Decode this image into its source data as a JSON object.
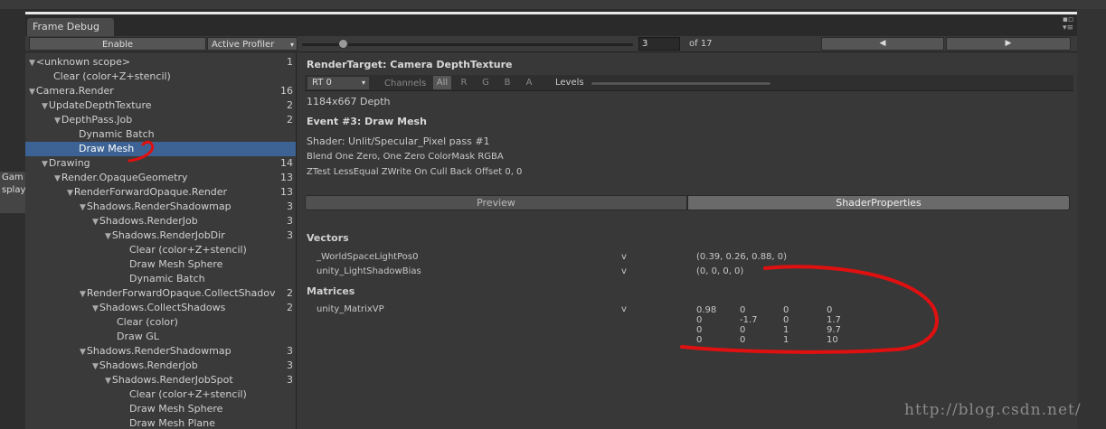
{
  "background": {
    "game_tab": "Gam",
    "display_label": "splay"
  },
  "window": {
    "tab_title": "Frame Debug",
    "icons": {
      "top": "▪▫",
      "bottom": "▾≡"
    }
  },
  "toolbar": {
    "enable_label": "Enable",
    "profiler_label": "Active Profiler",
    "profiler_arrow": "▾",
    "frame_value": "3",
    "of_label": "of 17",
    "prev_glyph": "◀",
    "next_glyph": "▶"
  },
  "tree": [
    {
      "label": "<unknown scope>",
      "count": "1",
      "indent": 0,
      "expanded": true,
      "selected": false
    },
    {
      "label": "Clear (color+Z+stencil)",
      "count": "",
      "indent": 1,
      "expanded": false,
      "selected": false
    },
    {
      "label": "Camera.Render",
      "count": "16",
      "indent": 0,
      "expanded": true,
      "selected": false
    },
    {
      "label": "UpdateDepthTexture",
      "count": "2",
      "indent": 1,
      "expanded": true,
      "selected": false
    },
    {
      "label": "DepthPass.Job",
      "count": "2",
      "indent": 2,
      "expanded": true,
      "selected": false
    },
    {
      "label": "Dynamic Batch",
      "count": "",
      "indent": 3,
      "expanded": false,
      "selected": false
    },
    {
      "label": "Draw Mesh",
      "count": "",
      "indent": 3,
      "expanded": false,
      "selected": true
    },
    {
      "label": "Drawing",
      "count": "14",
      "indent": 1,
      "expanded": true,
      "selected": false
    },
    {
      "label": "Render.OpaqueGeometry",
      "count": "13",
      "indent": 2,
      "expanded": true,
      "selected": false
    },
    {
      "label": "RenderForwardOpaque.Render",
      "count": "13",
      "indent": 3,
      "expanded": true,
      "selected": false
    },
    {
      "label": "Shadows.RenderShadowmap",
      "count": "3",
      "indent": 4,
      "expanded": true,
      "selected": false
    },
    {
      "label": "Shadows.RenderJob",
      "count": "3",
      "indent": 5,
      "expanded": true,
      "selected": false
    },
    {
      "label": "Shadows.RenderJobDir",
      "count": "3",
      "indent": 6,
      "expanded": true,
      "selected": false
    },
    {
      "label": "Clear (color+Z+stencil)",
      "count": "",
      "indent": 7,
      "expanded": false,
      "selected": false
    },
    {
      "label": "Draw Mesh Sphere",
      "count": "",
      "indent": 7,
      "expanded": false,
      "selected": false
    },
    {
      "label": "Dynamic Batch",
      "count": "",
      "indent": 7,
      "expanded": false,
      "selected": false
    },
    {
      "label": "RenderForwardOpaque.CollectShadov",
      "count": "2",
      "indent": 4,
      "expanded": true,
      "selected": false
    },
    {
      "label": "Shadows.CollectShadows",
      "count": "2",
      "indent": 5,
      "expanded": true,
      "selected": false
    },
    {
      "label": "Clear (color)",
      "count": "",
      "indent": 6,
      "expanded": false,
      "selected": false
    },
    {
      "label": "Draw GL",
      "count": "",
      "indent": 6,
      "expanded": false,
      "selected": false
    },
    {
      "label": "Shadows.RenderShadowmap",
      "count": "3",
      "indent": 4,
      "expanded": true,
      "selected": false
    },
    {
      "label": "Shadows.RenderJob",
      "count": "3",
      "indent": 5,
      "expanded": true,
      "selected": false
    },
    {
      "label": "Shadows.RenderJobSpot",
      "count": "3",
      "indent": 6,
      "expanded": true,
      "selected": false
    },
    {
      "label": "Clear (color+Z+stencil)",
      "count": "",
      "indent": 7,
      "expanded": false,
      "selected": false
    },
    {
      "label": "Draw Mesh Sphere",
      "count": "",
      "indent": 7,
      "expanded": false,
      "selected": false
    },
    {
      "label": "Draw Mesh Plane",
      "count": "",
      "indent": 7,
      "expanded": false,
      "selected": false
    }
  ],
  "render_target": {
    "title": "RenderTarget: Camera DepthTexture",
    "rt_select": "RT 0",
    "rt_arrow": "▾",
    "channels_label": "Channels",
    "channels": [
      "All",
      "R",
      "G",
      "B",
      "A"
    ],
    "levels_label": "Levels",
    "resolution": "1184x667 Depth"
  },
  "event": {
    "title": "Event #3: Draw Mesh",
    "shader": "Shader: Unlit/Specular_Pixel pass #1",
    "blend": "Blend One Zero, One Zero ColorMask RGBA",
    "ztest": "ZTest LessEqual ZWrite On Cull Back Offset 0, 0"
  },
  "tabs": {
    "preview": "Preview",
    "shader_properties": "ShaderProperties"
  },
  "vectors": {
    "heading": "Vectors",
    "items": [
      {
        "name": "_WorldSpaceLightPos0",
        "stage": "v",
        "value": "(0.39, 0.26, 0.88, 0)"
      },
      {
        "name": "unity_LightShadowBias",
        "stage": "v",
        "value": "(0, 0, 0, 0)"
      }
    ]
  },
  "matrices": {
    "heading": "Matrices",
    "items": [
      {
        "name": "unity_MatrixVP",
        "stage": "v",
        "rows": [
          [
            "0.98",
            "0",
            "0",
            "0"
          ],
          [
            "0",
            "-1.7",
            "0",
            "1.7"
          ],
          [
            "0",
            "0",
            "1",
            "9.7"
          ],
          [
            "0",
            "0",
            "1",
            "10"
          ]
        ]
      }
    ]
  },
  "watermark": "http://blog.csdn.net/",
  "colors": {
    "selection": "#3d6394",
    "annotation": "#e01010",
    "panel": "#383838"
  }
}
